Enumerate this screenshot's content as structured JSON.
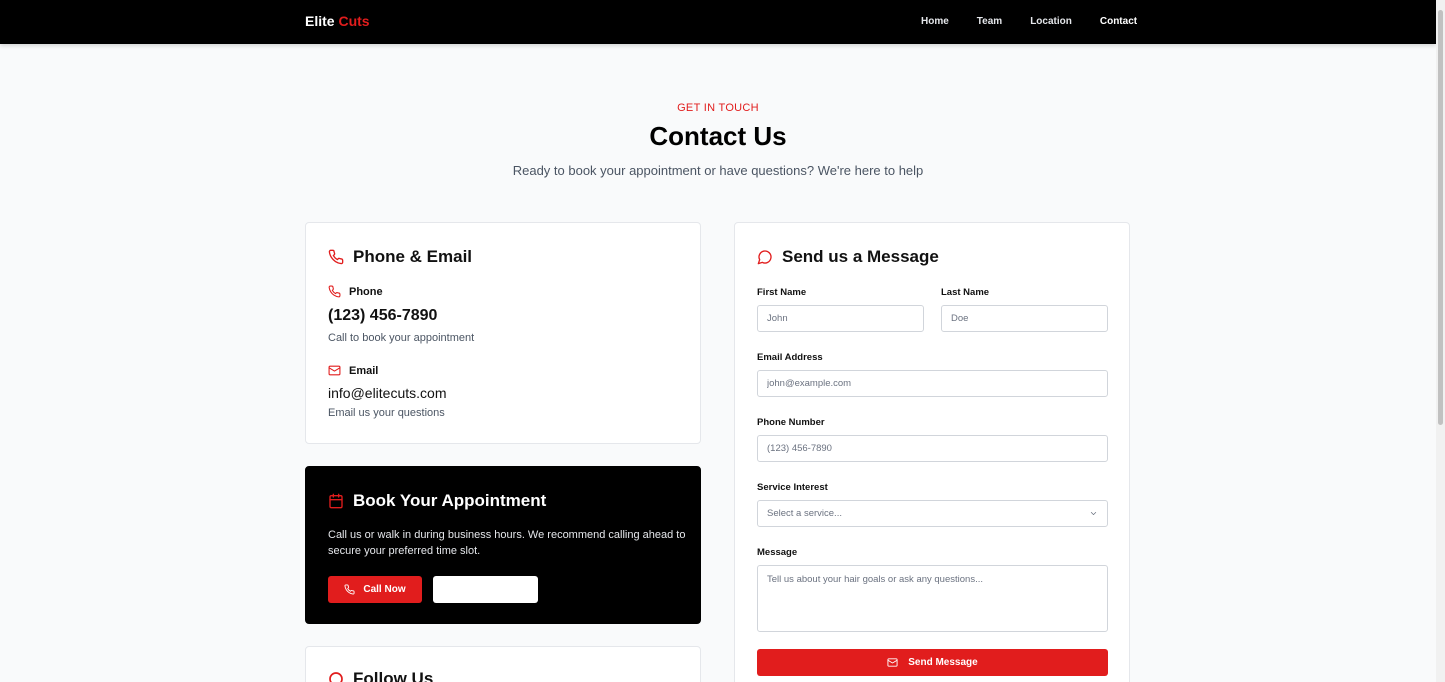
{
  "nav": {
    "brand_main": "Elite",
    "brand_accent": "Cuts",
    "links": [
      "Home",
      "Team",
      "Location",
      "Contact"
    ],
    "active": "Contact"
  },
  "hero": {
    "eyebrow": "GET IN TOUCH",
    "title": "Contact Us",
    "subtitle": "Ready to book your appointment or have questions? We're here to help"
  },
  "contact_card": {
    "heading": "Phone & Email",
    "phone_label": "Phone",
    "phone_value": "(123) 456-7890",
    "phone_note": "Call to book your appointment",
    "email_label": "Email",
    "email_value": "info@elitecuts.com",
    "email_note": "Email us your questions"
  },
  "booking_card": {
    "heading": "Book Your Appointment",
    "text": "Call us or walk in during business hours. We recommend calling ahead to secure your preferred time slot.",
    "call_label": "Call Now"
  },
  "follow_card": {
    "heading": "Follow Us"
  },
  "form": {
    "heading": "Send us a Message",
    "first_name_label": "First Name",
    "first_name_placeholder": "John",
    "last_name_label": "Last Name",
    "last_name_placeholder": "Doe",
    "email_label": "Email Address",
    "email_placeholder": "john@example.com",
    "phone_label": "Phone Number",
    "phone_placeholder": "(123) 456-7890",
    "service_label": "Service Interest",
    "service_selected": "Select a service...",
    "message_label": "Message",
    "message_placeholder": "Tell us about your hair goals or ask any questions...",
    "submit_label": "Send Message"
  },
  "colors": {
    "accent": "#e11d1d",
    "nav_bg": "#000000",
    "page_bg": "#f9fafb"
  },
  "icons": {
    "phone": "phone-icon",
    "email": "mail-icon",
    "calendar": "calendar-icon",
    "message": "message-circle-icon",
    "dropdown": "chevron-down-icon"
  }
}
